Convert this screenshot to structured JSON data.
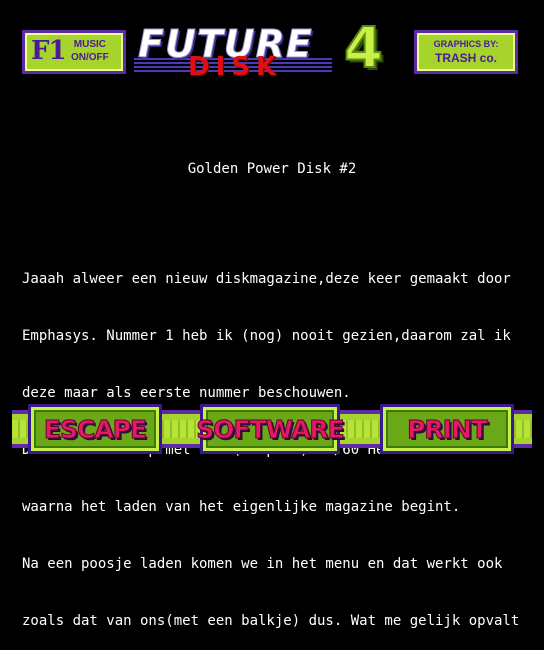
{
  "header": {
    "f1_key": "F1",
    "f1_label_line1": "MUSIC",
    "f1_label_line2": "ON/OFF",
    "logo_future": "FUTURE",
    "logo_disk": "DISK",
    "logo_number": "4",
    "credits_line1": "GRAPHICS BY:",
    "credits_line2": "TRASH co."
  },
  "article": {
    "title": "Golden Power Disk #2",
    "lines": [
      "Jaaah alweer een nieuw diskmagazine,deze keer gemaakt door",
      "Emphasys. Nummer 1 heb ik (nog) nooit gezien,daarom zal ik",
      "deze maar als eerste nummer beschouwen.",
      "De disk start op met een (simpele) 50/60 Hertz selector",
      "waarna het laden van het eigenlijke magazine begint.",
      "Na een poosje laden komen we in het menu en dat werkt ook",
      "zoals dat van ons(met een balkje) dus. Wat me gelijk opvalt"
    ]
  },
  "buttons": {
    "escape": "ESCAPE",
    "software": "SOFTWARE",
    "print": "PRINT"
  },
  "colors": {
    "background": "#000000",
    "panel_green": "#a6d42c",
    "border_purple": "#5e2aa8",
    "button_text_pink": "#e81868",
    "logo_red": "#e01010"
  }
}
